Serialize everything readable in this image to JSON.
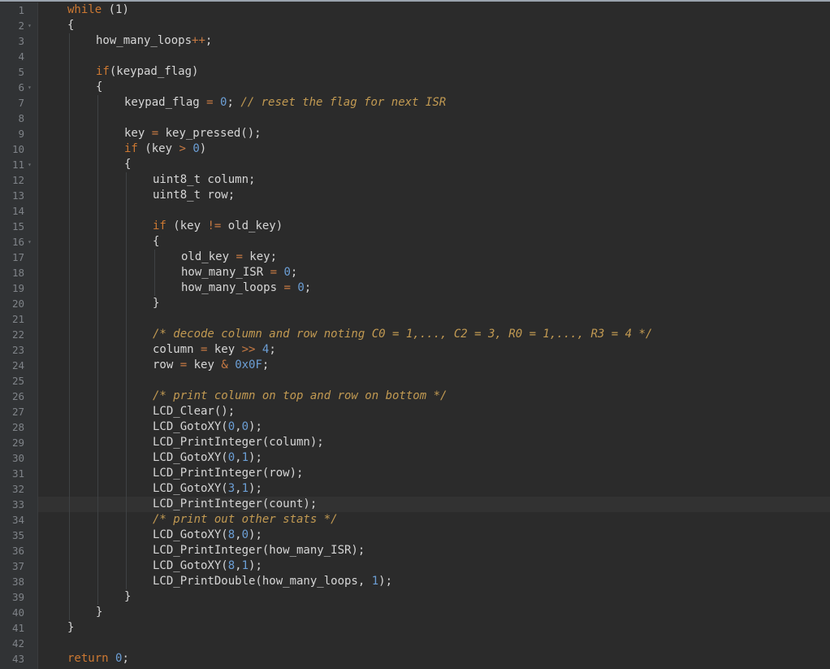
{
  "editor": {
    "lines": [
      {
        "n": "1",
        "fold": false,
        "indent": 0,
        "tokens": [
          {
            "t": "while",
            "c": "kw"
          },
          {
            "t": " (1)",
            "c": "p"
          }
        ]
      },
      {
        "n": "2",
        "fold": true,
        "indent": 0,
        "tokens": [
          {
            "t": "{",
            "c": "p"
          }
        ]
      },
      {
        "n": "3",
        "fold": false,
        "indent": 1,
        "tokens": [
          {
            "t": "how_many_loops",
            "c": "p"
          },
          {
            "t": "++",
            "c": "op"
          },
          {
            "t": ";",
            "c": "p"
          }
        ]
      },
      {
        "n": "4",
        "fold": false,
        "indent": 1,
        "tokens": []
      },
      {
        "n": "5",
        "fold": false,
        "indent": 1,
        "tokens": [
          {
            "t": "if",
            "c": "kw"
          },
          {
            "t": "(keypad_flag)",
            "c": "p"
          }
        ]
      },
      {
        "n": "6",
        "fold": true,
        "indent": 1,
        "tokens": [
          {
            "t": "{",
            "c": "p"
          }
        ]
      },
      {
        "n": "7",
        "fold": false,
        "indent": 2,
        "tokens": [
          {
            "t": "keypad_flag ",
            "c": "p"
          },
          {
            "t": "=",
            "c": "op"
          },
          {
            "t": " ",
            "c": "p"
          },
          {
            "t": "0",
            "c": "num"
          },
          {
            "t": "; ",
            "c": "p"
          },
          {
            "t": "// reset the flag for next ISR",
            "c": "cm"
          }
        ]
      },
      {
        "n": "8",
        "fold": false,
        "indent": 2,
        "tokens": []
      },
      {
        "n": "9",
        "fold": false,
        "indent": 2,
        "tokens": [
          {
            "t": "key ",
            "c": "p"
          },
          {
            "t": "=",
            "c": "op"
          },
          {
            "t": " key_pressed();",
            "c": "p"
          }
        ]
      },
      {
        "n": "10",
        "fold": false,
        "indent": 2,
        "tokens": [
          {
            "t": "if",
            "c": "kw"
          },
          {
            "t": " (key ",
            "c": "p"
          },
          {
            "t": ">",
            "c": "op"
          },
          {
            "t": " ",
            "c": "p"
          },
          {
            "t": "0",
            "c": "num"
          },
          {
            "t": ")",
            "c": "p"
          }
        ]
      },
      {
        "n": "11",
        "fold": true,
        "indent": 2,
        "tokens": [
          {
            "t": "{",
            "c": "p"
          }
        ]
      },
      {
        "n": "12",
        "fold": false,
        "indent": 3,
        "tokens": [
          {
            "t": "uint8_t column;",
            "c": "p"
          }
        ]
      },
      {
        "n": "13",
        "fold": false,
        "indent": 3,
        "tokens": [
          {
            "t": "uint8_t row;",
            "c": "p"
          }
        ]
      },
      {
        "n": "14",
        "fold": false,
        "indent": 3,
        "tokens": []
      },
      {
        "n": "15",
        "fold": false,
        "indent": 3,
        "tokens": [
          {
            "t": "if",
            "c": "kw"
          },
          {
            "t": " (key ",
            "c": "p"
          },
          {
            "t": "!=",
            "c": "op"
          },
          {
            "t": " old_key)",
            "c": "p"
          }
        ]
      },
      {
        "n": "16",
        "fold": true,
        "indent": 3,
        "tokens": [
          {
            "t": "{",
            "c": "p"
          }
        ]
      },
      {
        "n": "17",
        "fold": false,
        "indent": 4,
        "tokens": [
          {
            "t": "old_key ",
            "c": "p"
          },
          {
            "t": "=",
            "c": "op"
          },
          {
            "t": " key;",
            "c": "p"
          }
        ]
      },
      {
        "n": "18",
        "fold": false,
        "indent": 4,
        "tokens": [
          {
            "t": "how_many_ISR ",
            "c": "p"
          },
          {
            "t": "=",
            "c": "op"
          },
          {
            "t": " ",
            "c": "p"
          },
          {
            "t": "0",
            "c": "num"
          },
          {
            "t": ";",
            "c": "p"
          }
        ]
      },
      {
        "n": "19",
        "fold": false,
        "indent": 4,
        "tokens": [
          {
            "t": "how_many_loops ",
            "c": "p"
          },
          {
            "t": "=",
            "c": "op"
          },
          {
            "t": " ",
            "c": "p"
          },
          {
            "t": "0",
            "c": "num"
          },
          {
            "t": ";",
            "c": "p"
          }
        ]
      },
      {
        "n": "20",
        "fold": false,
        "indent": 3,
        "tokens": [
          {
            "t": "}",
            "c": "p"
          }
        ]
      },
      {
        "n": "21",
        "fold": false,
        "indent": 3,
        "tokens": []
      },
      {
        "n": "22",
        "fold": false,
        "indent": 3,
        "tokens": [
          {
            "t": "/* decode column and row noting C0 = 1,..., C2 = 3, R0 = 1,..., R3 = 4 */",
            "c": "cm"
          }
        ]
      },
      {
        "n": "23",
        "fold": false,
        "indent": 3,
        "tokens": [
          {
            "t": "column ",
            "c": "p"
          },
          {
            "t": "=",
            "c": "op"
          },
          {
            "t": " key ",
            "c": "p"
          },
          {
            "t": ">>",
            "c": "op"
          },
          {
            "t": " ",
            "c": "p"
          },
          {
            "t": "4",
            "c": "num"
          },
          {
            "t": ";",
            "c": "p"
          }
        ]
      },
      {
        "n": "24",
        "fold": false,
        "indent": 3,
        "tokens": [
          {
            "t": "row ",
            "c": "p"
          },
          {
            "t": "=",
            "c": "op"
          },
          {
            "t": " key ",
            "c": "p"
          },
          {
            "t": "&",
            "c": "op"
          },
          {
            "t": " ",
            "c": "p"
          },
          {
            "t": "0x0F",
            "c": "num"
          },
          {
            "t": ";",
            "c": "p"
          }
        ]
      },
      {
        "n": "25",
        "fold": false,
        "indent": 3,
        "tokens": []
      },
      {
        "n": "26",
        "fold": false,
        "indent": 3,
        "tokens": [
          {
            "t": "/* print column on top and row on bottom */",
            "c": "cm"
          }
        ]
      },
      {
        "n": "27",
        "fold": false,
        "indent": 3,
        "tokens": [
          {
            "t": "LCD_Clear();",
            "c": "p"
          }
        ]
      },
      {
        "n": "28",
        "fold": false,
        "indent": 3,
        "tokens": [
          {
            "t": "LCD_GotoXY(",
            "c": "p"
          },
          {
            "t": "0",
            "c": "num"
          },
          {
            "t": ",",
            "c": "p"
          },
          {
            "t": "0",
            "c": "num"
          },
          {
            "t": ");",
            "c": "p"
          }
        ]
      },
      {
        "n": "29",
        "fold": false,
        "indent": 3,
        "tokens": [
          {
            "t": "LCD_PrintInteger(column);",
            "c": "p"
          }
        ]
      },
      {
        "n": "30",
        "fold": false,
        "indent": 3,
        "tokens": [
          {
            "t": "LCD_GotoXY(",
            "c": "p"
          },
          {
            "t": "0",
            "c": "num"
          },
          {
            "t": ",",
            "c": "p"
          },
          {
            "t": "1",
            "c": "num"
          },
          {
            "t": ");",
            "c": "p"
          }
        ]
      },
      {
        "n": "31",
        "fold": false,
        "indent": 3,
        "tokens": [
          {
            "t": "LCD_PrintInteger(row);",
            "c": "p"
          }
        ]
      },
      {
        "n": "32",
        "fold": false,
        "indent": 3,
        "tokens": [
          {
            "t": "LCD_GotoXY(",
            "c": "p"
          },
          {
            "t": "3",
            "c": "num"
          },
          {
            "t": ",",
            "c": "p"
          },
          {
            "t": "1",
            "c": "num"
          },
          {
            "t": ");",
            "c": "p"
          }
        ]
      },
      {
        "n": "33",
        "fold": false,
        "indent": 3,
        "current": true,
        "tokens": [
          {
            "t": "LCD_PrintInteger(count);",
            "c": "p"
          }
        ]
      },
      {
        "n": "34",
        "fold": false,
        "indent": 3,
        "tokens": [
          {
            "t": "/* print out other stats */",
            "c": "cm"
          }
        ]
      },
      {
        "n": "35",
        "fold": false,
        "indent": 3,
        "tokens": [
          {
            "t": "LCD_GotoXY(",
            "c": "p"
          },
          {
            "t": "8",
            "c": "num"
          },
          {
            "t": ",",
            "c": "p"
          },
          {
            "t": "0",
            "c": "num"
          },
          {
            "t": ");",
            "c": "p"
          }
        ]
      },
      {
        "n": "36",
        "fold": false,
        "indent": 3,
        "tokens": [
          {
            "t": "LCD_PrintInteger(how_many_ISR);",
            "c": "p"
          }
        ]
      },
      {
        "n": "37",
        "fold": false,
        "indent": 3,
        "tokens": [
          {
            "t": "LCD_GotoXY(",
            "c": "p"
          },
          {
            "t": "8",
            "c": "num"
          },
          {
            "t": ",",
            "c": "p"
          },
          {
            "t": "1",
            "c": "num"
          },
          {
            "t": ");",
            "c": "p"
          }
        ]
      },
      {
        "n": "38",
        "fold": false,
        "indent": 3,
        "tokens": [
          {
            "t": "LCD_PrintDouble(how_many_loops, ",
            "c": "p"
          },
          {
            "t": "1",
            "c": "num"
          },
          {
            "t": ");",
            "c": "p"
          }
        ]
      },
      {
        "n": "39",
        "fold": false,
        "indent": 2,
        "tokens": [
          {
            "t": "}",
            "c": "p"
          }
        ]
      },
      {
        "n": "40",
        "fold": false,
        "indent": 1,
        "tokens": [
          {
            "t": "}",
            "c": "p"
          }
        ]
      },
      {
        "n": "41",
        "fold": false,
        "indent": 0,
        "tokens": [
          {
            "t": "}",
            "c": "p"
          }
        ]
      },
      {
        "n": "42",
        "fold": false,
        "indent": 0,
        "tokens": []
      },
      {
        "n": "43",
        "fold": false,
        "indent": 0,
        "tokens": [
          {
            "t": "return",
            "c": "kw"
          },
          {
            "t": " ",
            "c": "p"
          },
          {
            "t": "0",
            "c": "num"
          },
          {
            "t": ";",
            "c": "p"
          }
        ]
      }
    ]
  },
  "colors": {
    "background": "#2b2b2b",
    "gutter": "#313335",
    "keyword": "#cc7832",
    "comment": "#c29a52",
    "number": "#6c9fd6",
    "text": "#d6d6d6"
  }
}
